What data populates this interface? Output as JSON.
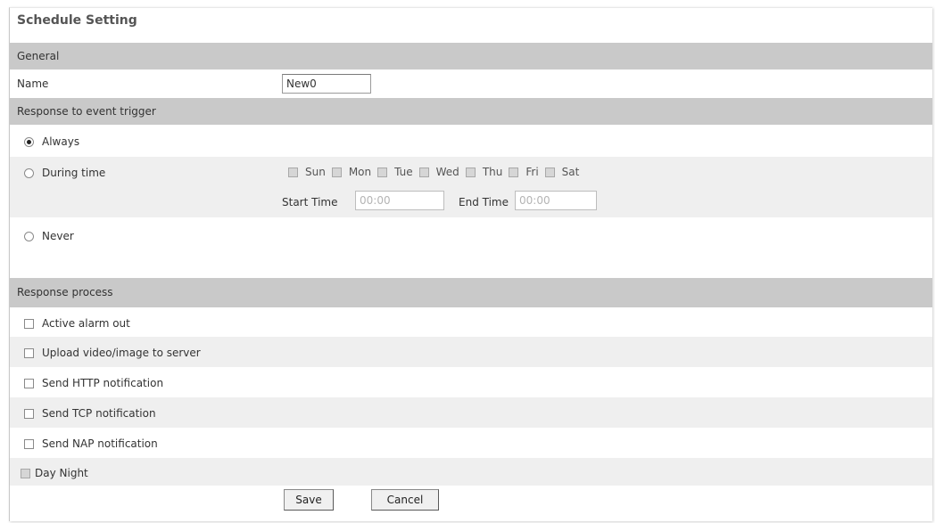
{
  "title": "Schedule Setting",
  "general": {
    "header": "General",
    "name_label": "Name",
    "name_value": "New0"
  },
  "event_trigger": {
    "header": "Response to event trigger",
    "options": [
      {
        "label": "Always",
        "checked": true
      },
      {
        "label": "During time",
        "checked": false
      },
      {
        "label": "Never",
        "checked": false
      }
    ],
    "days": [
      "Sun",
      "Mon",
      "Tue",
      "Wed",
      "Thu",
      "Fri",
      "Sat"
    ],
    "start_time_label": "Start Time",
    "start_time_value": "00:00",
    "end_time_label": "End Time",
    "end_time_value": "00:00"
  },
  "response_process": {
    "header": "Response process",
    "items": [
      {
        "label": "Active alarm out",
        "checked": false,
        "disabled": false
      },
      {
        "label": "Upload video/image to server",
        "checked": false,
        "disabled": false
      },
      {
        "label": "Send HTTP notification",
        "checked": false,
        "disabled": false
      },
      {
        "label": "Send TCP notification",
        "checked": false,
        "disabled": false
      },
      {
        "label": "Send NAP notification",
        "checked": false,
        "disabled": false
      },
      {
        "label": "Day Night",
        "checked": false,
        "disabled": true
      }
    ]
  },
  "buttons": {
    "save": "Save",
    "cancel": "Cancel"
  },
  "colors": {
    "header_bg": "#c9c9c9",
    "alt_row_bg": "#efefef",
    "title_color": "#555555"
  }
}
